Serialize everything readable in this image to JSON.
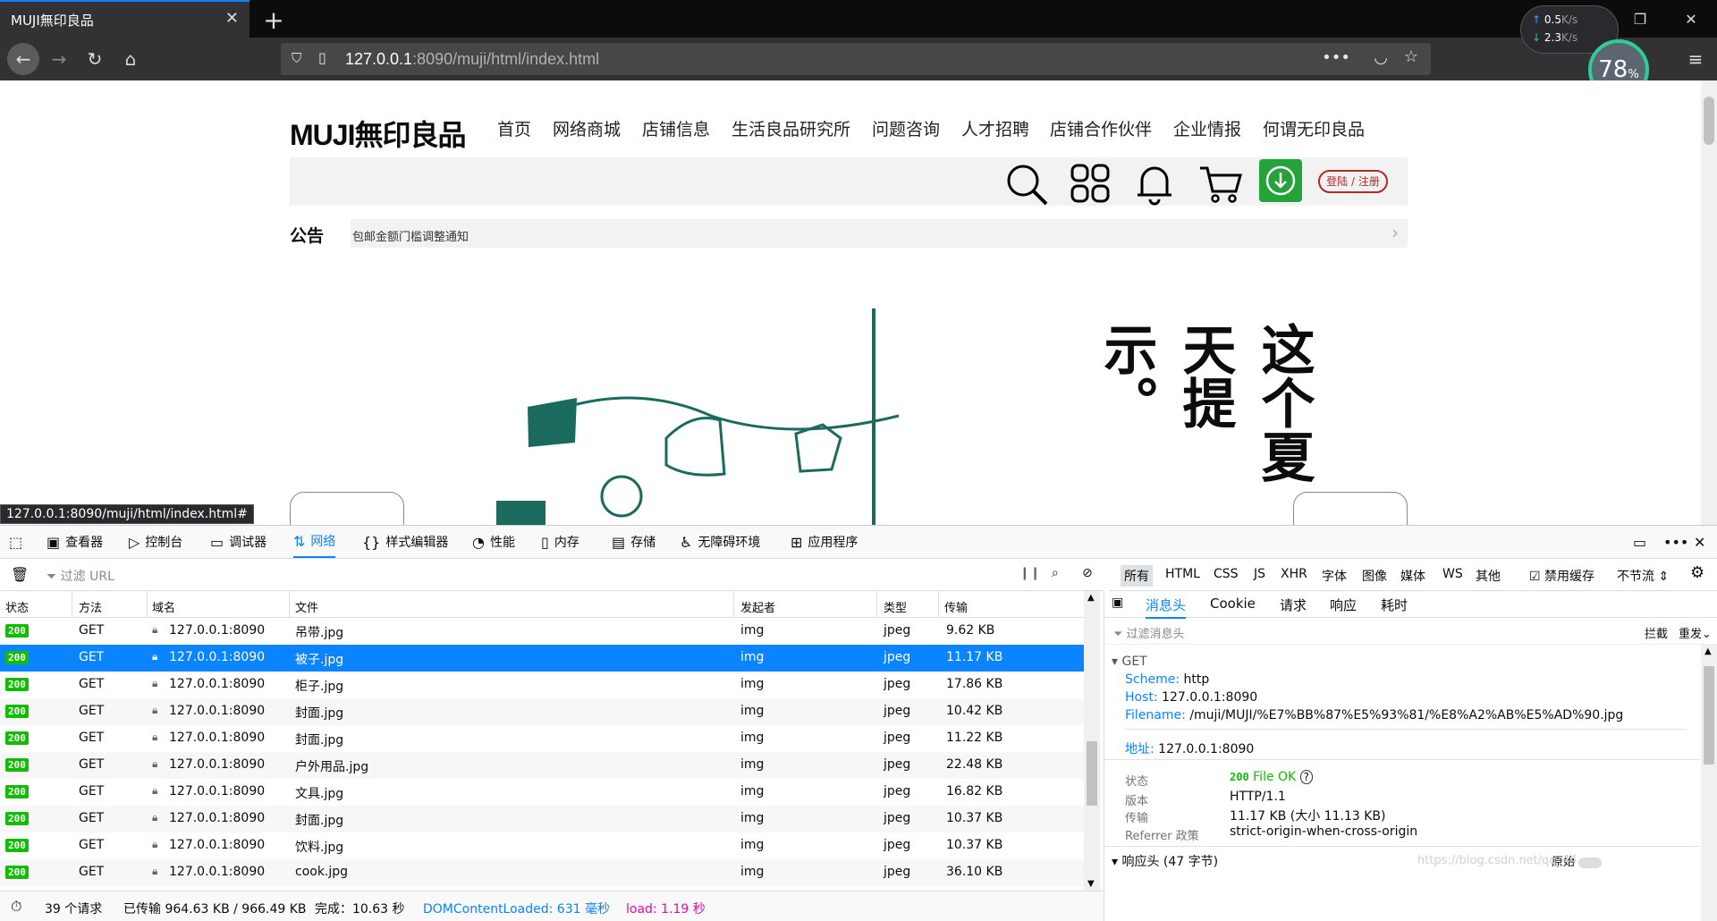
{
  "browser": {
    "tab_title": "MUJI無印良品",
    "url_host": "127.0.0.1",
    "url_rest": ":8090/muji/html/index.html",
    "speed_up": "0.5",
    "speed_up_unit": "K/s",
    "speed_down": "2.3",
    "speed_down_unit": "K/s",
    "speed_gauge": "78",
    "speed_gauge_unit": "%",
    "status_link": "127.0.0.1:8090/muji/html/index.html#"
  },
  "site": {
    "logo": "MUJI無印良品",
    "nav": [
      "首页",
      "网络商城",
      "店铺信息",
      "生活良品研究所",
      "问题咨询",
      "人才招聘",
      "店铺合作伙伴",
      "企业情报",
      "何谓无印良品"
    ],
    "login": "登陆 / 注册",
    "notice_label": "公告",
    "notice_text": "包邮金额门槛调整通知",
    "banner_text": "这个夏天提示。"
  },
  "devtools": {
    "tabs": [
      "查看器",
      "控制台",
      "调试器",
      "网络",
      "样式编辑器",
      "性能",
      "内存",
      "存储",
      "无障碍环境",
      "应用程序"
    ],
    "selected_tab": "网络",
    "filter_placeholder": "过滤 URL",
    "filter_types": [
      "所有",
      "HTML",
      "CSS",
      "JS",
      "XHR",
      "字体",
      "图像",
      "媒体",
      "WS",
      "其他"
    ],
    "disable_cache": "禁用缓存",
    "throttle": "不节流",
    "columns": [
      "状态",
      "方法",
      "域名",
      "文件",
      "发起者",
      "类型",
      "传输"
    ],
    "rows": [
      {
        "status": "200",
        "method": "GET",
        "domain": "127.0.0.1:8090",
        "file": "吊带.jpg",
        "initiator": "img",
        "type": "jpeg",
        "size": "9.62 KB"
      },
      {
        "status": "200",
        "method": "GET",
        "domain": "127.0.0.1:8090",
        "file": "被子.jpg",
        "initiator": "img",
        "type": "jpeg",
        "size": "11.17 KB"
      },
      {
        "status": "200",
        "method": "GET",
        "domain": "127.0.0.1:8090",
        "file": "柜子.jpg",
        "initiator": "img",
        "type": "jpeg",
        "size": "17.86 KB"
      },
      {
        "status": "200",
        "method": "GET",
        "domain": "127.0.0.1:8090",
        "file": "封面.jpg",
        "initiator": "img",
        "type": "jpeg",
        "size": "10.42 KB"
      },
      {
        "status": "200",
        "method": "GET",
        "domain": "127.0.0.1:8090",
        "file": "封面.jpg",
        "initiator": "img",
        "type": "jpeg",
        "size": "11.22 KB"
      },
      {
        "status": "200",
        "method": "GET",
        "domain": "127.0.0.1:8090",
        "file": "户外用品.jpg",
        "initiator": "img",
        "type": "jpeg",
        "size": "22.48 KB"
      },
      {
        "status": "200",
        "method": "GET",
        "domain": "127.0.0.1:8090",
        "file": "文具.jpg",
        "initiator": "img",
        "type": "jpeg",
        "size": "16.82 KB"
      },
      {
        "status": "200",
        "method": "GET",
        "domain": "127.0.0.1:8090",
        "file": "封面.jpg",
        "initiator": "img",
        "type": "jpeg",
        "size": "10.37 KB"
      },
      {
        "status": "200",
        "method": "GET",
        "domain": "127.0.0.1:8090",
        "file": "饮料.jpg",
        "initiator": "img",
        "type": "jpeg",
        "size": "10.37 KB"
      },
      {
        "status": "200",
        "method": "GET",
        "domain": "127.0.0.1:8090",
        "file": "cook.jpg",
        "initiator": "img",
        "type": "jpeg",
        "size": "36.10 KB"
      }
    ],
    "summary": {
      "requests": "39 个请求",
      "transferred": "已传输 964.63 KB / 966.49 KB",
      "finish": "完成：10.63 秒",
      "dcl": "DOMContentLoaded: 631 毫秒",
      "load": "load: 1.19 秒"
    },
    "side": {
      "tabs": [
        "消息头",
        "Cookie",
        "请求",
        "响应",
        "耗时"
      ],
      "filter_placeholder": "过滤消息头",
      "block": "拦截",
      "resend": "重发",
      "method": "GET",
      "scheme_k": "Scheme:",
      "scheme_v": "http",
      "host_k": "Host:",
      "host_v": "127.0.0.1:8090",
      "filename_k": "Filename:",
      "filename_v": "/muji/MUJI/%E7%BB%87%E5%93%81/%E8%A2%AB%E5%AD%90.jpg",
      "address_k": "地址:",
      "address_v": "127.0.0.1:8090",
      "status_l": "状态",
      "status_code": "200",
      "status_text": "File OK",
      "version_l": "版本",
      "version_v": "HTTP/1.1",
      "transfer_l": "传输",
      "transfer_v": "11.17 KB (大小 11.13 KB)",
      "referrer_l": "Referrer 政策",
      "referrer_v": "strict-origin-when-cross-origin",
      "resp_headers": "响应头 (47 字节)",
      "raw": "原始",
      "watermark": "https://blog.csdn.net/qq_44"
    }
  }
}
